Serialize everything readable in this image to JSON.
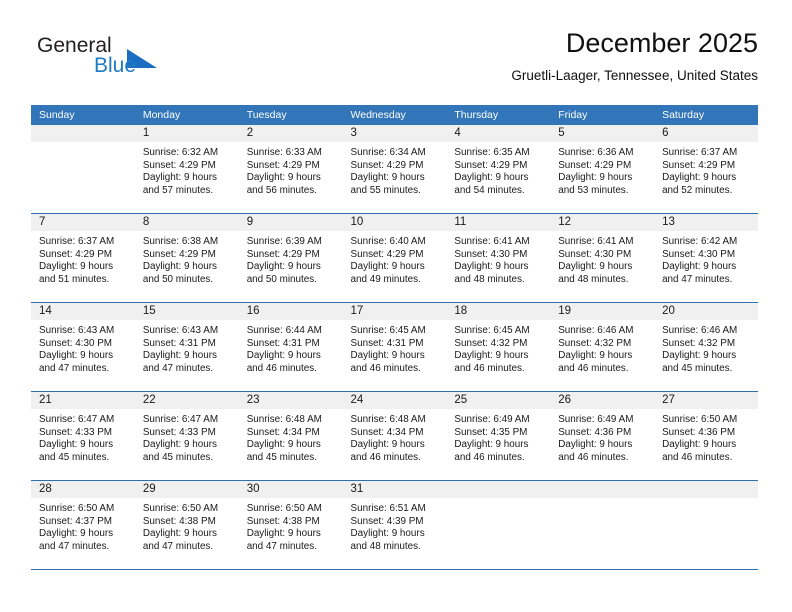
{
  "brand": {
    "name_part1": "General",
    "name_part2": "Blue"
  },
  "header": {
    "title": "December 2025",
    "subtitle": "Gruetli-Laager, Tennessee, United States"
  },
  "colors": {
    "header_blue": "#3275b8",
    "row_divider_blue": "#2f6fad",
    "daynum_band": "#f0f0f0",
    "logo_blue": "#1b6ec2"
  },
  "weekday_headers": [
    "Sunday",
    "Monday",
    "Tuesday",
    "Wednesday",
    "Thursday",
    "Friday",
    "Saturday"
  ],
  "weeks": [
    [
      {
        "day": "",
        "sunrise": "",
        "sunset": "",
        "daylight1": "",
        "daylight2": "",
        "empty": true
      },
      {
        "day": "1",
        "sunrise": "Sunrise: 6:32 AM",
        "sunset": "Sunset: 4:29 PM",
        "daylight1": "Daylight: 9 hours",
        "daylight2": "and 57 minutes."
      },
      {
        "day": "2",
        "sunrise": "Sunrise: 6:33 AM",
        "sunset": "Sunset: 4:29 PM",
        "daylight1": "Daylight: 9 hours",
        "daylight2": "and 56 minutes."
      },
      {
        "day": "3",
        "sunrise": "Sunrise: 6:34 AM",
        "sunset": "Sunset: 4:29 PM",
        "daylight1": "Daylight: 9 hours",
        "daylight2": "and 55 minutes."
      },
      {
        "day": "4",
        "sunrise": "Sunrise: 6:35 AM",
        "sunset": "Sunset: 4:29 PM",
        "daylight1": "Daylight: 9 hours",
        "daylight2": "and 54 minutes."
      },
      {
        "day": "5",
        "sunrise": "Sunrise: 6:36 AM",
        "sunset": "Sunset: 4:29 PM",
        "daylight1": "Daylight: 9 hours",
        "daylight2": "and 53 minutes."
      },
      {
        "day": "6",
        "sunrise": "Sunrise: 6:37 AM",
        "sunset": "Sunset: 4:29 PM",
        "daylight1": "Daylight: 9 hours",
        "daylight2": "and 52 minutes."
      }
    ],
    [
      {
        "day": "7",
        "sunrise": "Sunrise: 6:37 AM",
        "sunset": "Sunset: 4:29 PM",
        "daylight1": "Daylight: 9 hours",
        "daylight2": "and 51 minutes."
      },
      {
        "day": "8",
        "sunrise": "Sunrise: 6:38 AM",
        "sunset": "Sunset: 4:29 PM",
        "daylight1": "Daylight: 9 hours",
        "daylight2": "and 50 minutes."
      },
      {
        "day": "9",
        "sunrise": "Sunrise: 6:39 AM",
        "sunset": "Sunset: 4:29 PM",
        "daylight1": "Daylight: 9 hours",
        "daylight2": "and 50 minutes."
      },
      {
        "day": "10",
        "sunrise": "Sunrise: 6:40 AM",
        "sunset": "Sunset: 4:29 PM",
        "daylight1": "Daylight: 9 hours",
        "daylight2": "and 49 minutes."
      },
      {
        "day": "11",
        "sunrise": "Sunrise: 6:41 AM",
        "sunset": "Sunset: 4:30 PM",
        "daylight1": "Daylight: 9 hours",
        "daylight2": "and 48 minutes."
      },
      {
        "day": "12",
        "sunrise": "Sunrise: 6:41 AM",
        "sunset": "Sunset: 4:30 PM",
        "daylight1": "Daylight: 9 hours",
        "daylight2": "and 48 minutes."
      },
      {
        "day": "13",
        "sunrise": "Sunrise: 6:42 AM",
        "sunset": "Sunset: 4:30 PM",
        "daylight1": "Daylight: 9 hours",
        "daylight2": "and 47 minutes."
      }
    ],
    [
      {
        "day": "14",
        "sunrise": "Sunrise: 6:43 AM",
        "sunset": "Sunset: 4:30 PM",
        "daylight1": "Daylight: 9 hours",
        "daylight2": "and 47 minutes."
      },
      {
        "day": "15",
        "sunrise": "Sunrise: 6:43 AM",
        "sunset": "Sunset: 4:31 PM",
        "daylight1": "Daylight: 9 hours",
        "daylight2": "and 47 minutes."
      },
      {
        "day": "16",
        "sunrise": "Sunrise: 6:44 AM",
        "sunset": "Sunset: 4:31 PM",
        "daylight1": "Daylight: 9 hours",
        "daylight2": "and 46 minutes."
      },
      {
        "day": "17",
        "sunrise": "Sunrise: 6:45 AM",
        "sunset": "Sunset: 4:31 PM",
        "daylight1": "Daylight: 9 hours",
        "daylight2": "and 46 minutes."
      },
      {
        "day": "18",
        "sunrise": "Sunrise: 6:45 AM",
        "sunset": "Sunset: 4:32 PM",
        "daylight1": "Daylight: 9 hours",
        "daylight2": "and 46 minutes."
      },
      {
        "day": "19",
        "sunrise": "Sunrise: 6:46 AM",
        "sunset": "Sunset: 4:32 PM",
        "daylight1": "Daylight: 9 hours",
        "daylight2": "and 46 minutes."
      },
      {
        "day": "20",
        "sunrise": "Sunrise: 6:46 AM",
        "sunset": "Sunset: 4:32 PM",
        "daylight1": "Daylight: 9 hours",
        "daylight2": "and 45 minutes."
      }
    ],
    [
      {
        "day": "21",
        "sunrise": "Sunrise: 6:47 AM",
        "sunset": "Sunset: 4:33 PM",
        "daylight1": "Daylight: 9 hours",
        "daylight2": "and 45 minutes."
      },
      {
        "day": "22",
        "sunrise": "Sunrise: 6:47 AM",
        "sunset": "Sunset: 4:33 PM",
        "daylight1": "Daylight: 9 hours",
        "daylight2": "and 45 minutes."
      },
      {
        "day": "23",
        "sunrise": "Sunrise: 6:48 AM",
        "sunset": "Sunset: 4:34 PM",
        "daylight1": "Daylight: 9 hours",
        "daylight2": "and 45 minutes."
      },
      {
        "day": "24",
        "sunrise": "Sunrise: 6:48 AM",
        "sunset": "Sunset: 4:34 PM",
        "daylight1": "Daylight: 9 hours",
        "daylight2": "and 46 minutes."
      },
      {
        "day": "25",
        "sunrise": "Sunrise: 6:49 AM",
        "sunset": "Sunset: 4:35 PM",
        "daylight1": "Daylight: 9 hours",
        "daylight2": "and 46 minutes."
      },
      {
        "day": "26",
        "sunrise": "Sunrise: 6:49 AM",
        "sunset": "Sunset: 4:36 PM",
        "daylight1": "Daylight: 9 hours",
        "daylight2": "and 46 minutes."
      },
      {
        "day": "27",
        "sunrise": "Sunrise: 6:50 AM",
        "sunset": "Sunset: 4:36 PM",
        "daylight1": "Daylight: 9 hours",
        "daylight2": "and 46 minutes."
      }
    ],
    [
      {
        "day": "28",
        "sunrise": "Sunrise: 6:50 AM",
        "sunset": "Sunset: 4:37 PM",
        "daylight1": "Daylight: 9 hours",
        "daylight2": "and 47 minutes."
      },
      {
        "day": "29",
        "sunrise": "Sunrise: 6:50 AM",
        "sunset": "Sunset: 4:38 PM",
        "daylight1": "Daylight: 9 hours",
        "daylight2": "and 47 minutes."
      },
      {
        "day": "30",
        "sunrise": "Sunrise: 6:50 AM",
        "sunset": "Sunset: 4:38 PM",
        "daylight1": "Daylight: 9 hours",
        "daylight2": "and 47 minutes."
      },
      {
        "day": "31",
        "sunrise": "Sunrise: 6:51 AM",
        "sunset": "Sunset: 4:39 PM",
        "daylight1": "Daylight: 9 hours",
        "daylight2": "and 48 minutes."
      },
      {
        "day": "",
        "sunrise": "",
        "sunset": "",
        "daylight1": "",
        "daylight2": "",
        "empty": true
      },
      {
        "day": "",
        "sunrise": "",
        "sunset": "",
        "daylight1": "",
        "daylight2": "",
        "empty": true
      },
      {
        "day": "",
        "sunrise": "",
        "sunset": "",
        "daylight1": "",
        "daylight2": "",
        "empty": true
      }
    ]
  ]
}
